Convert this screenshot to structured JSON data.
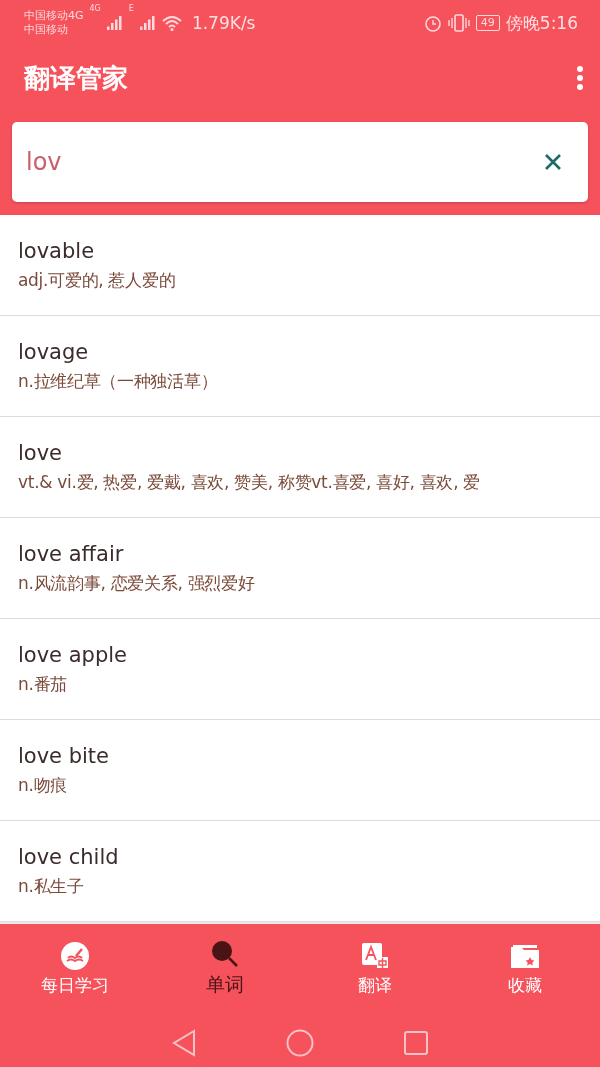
{
  "status_bar": {
    "carrier_1": "中国移动4G",
    "carrier_2": "中国移动",
    "network_1": "4G",
    "network_2": "E",
    "speed": "1.79K/s",
    "battery": "49",
    "time": "傍晚5:16"
  },
  "app_bar": {
    "title": "翻译管家"
  },
  "search": {
    "value": "lov"
  },
  "results": [
    {
      "word": "lovable",
      "definition": "adj.可爱的, 惹人爱的"
    },
    {
      "word": "lovage",
      "definition": "n.拉维纪草（一种独活草）"
    },
    {
      "word": "love",
      "definition": "vt.& vi.爱, 热爱, 爱戴, 喜欢, 赞美, 称赞vt.喜爱, 喜好, 喜欢, 爱"
    },
    {
      "word": "love affair",
      "definition": "n.风流韵事, 恋爱关系, 强烈爱好"
    },
    {
      "word": "love apple",
      "definition": "n.番茄"
    },
    {
      "word": "love bite",
      "definition": "n.吻痕"
    },
    {
      "word": "love child",
      "definition": "n.私生子"
    }
  ],
  "bottom_nav": [
    {
      "kind": "study",
      "label": "每日学习",
      "selected": false
    },
    {
      "kind": "word",
      "label": "单词",
      "selected": true
    },
    {
      "kind": "translate",
      "label": "翻译",
      "selected": false
    },
    {
      "kind": "favorites",
      "label": "收藏",
      "selected": false
    }
  ]
}
